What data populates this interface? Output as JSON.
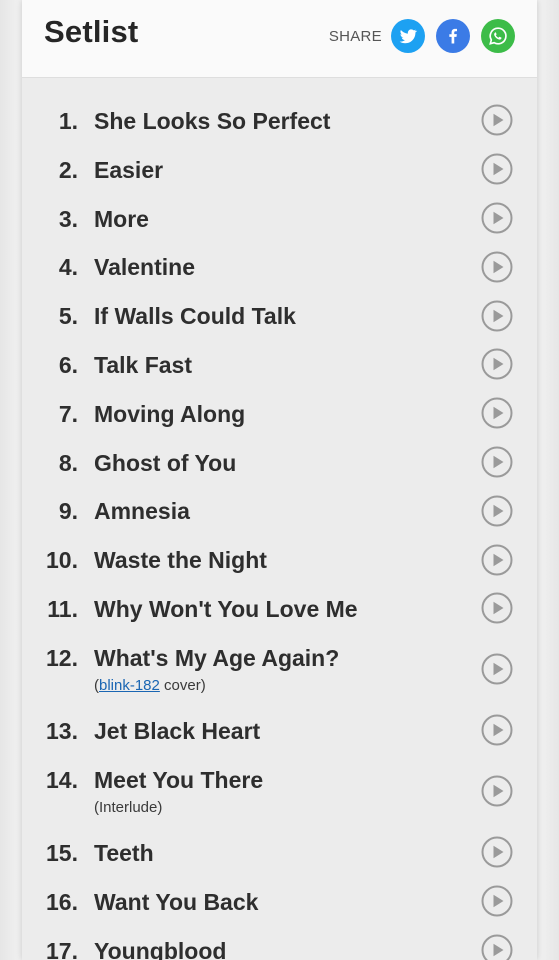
{
  "header": {
    "title": "Setlist",
    "share_label": "SHARE",
    "social": [
      {
        "icon": "twitter-icon",
        "color": "#1da1f2"
      },
      {
        "icon": "facebook-icon",
        "color": "#3b7be6"
      },
      {
        "icon": "whatsapp-icon",
        "color": "#3cbc48"
      }
    ]
  },
  "setlist": {
    "songs": [
      {
        "number": "1.",
        "title": "She Looks So Perfect"
      },
      {
        "number": "2.",
        "title": "Easier"
      },
      {
        "number": "3.",
        "title": "More"
      },
      {
        "number": "4.",
        "title": "Valentine"
      },
      {
        "number": "5.",
        "title": "If Walls Could Talk"
      },
      {
        "number": "6.",
        "title": "Talk Fast"
      },
      {
        "number": "7.",
        "title": "Moving Along"
      },
      {
        "number": "8.",
        "title": "Ghost of You"
      },
      {
        "number": "9.",
        "title": "Amnesia"
      },
      {
        "number": "10.",
        "title": "Waste the Night"
      },
      {
        "number": "11.",
        "title": "Why Won't You Love Me"
      },
      {
        "number": "12.",
        "title": "What's My Age Again?",
        "note_open": "(",
        "note_link": "blink-182",
        "note_close": " cover)"
      },
      {
        "number": "13.",
        "title": "Jet Black Heart"
      },
      {
        "number": "14.",
        "title": "Meet You There",
        "note": "(Interlude)"
      },
      {
        "number": "15.",
        "title": "Teeth"
      },
      {
        "number": "16.",
        "title": "Want You Back"
      },
      {
        "number": "17.",
        "title": "Youngblood"
      }
    ],
    "play_icon": "play-circle-icon"
  }
}
